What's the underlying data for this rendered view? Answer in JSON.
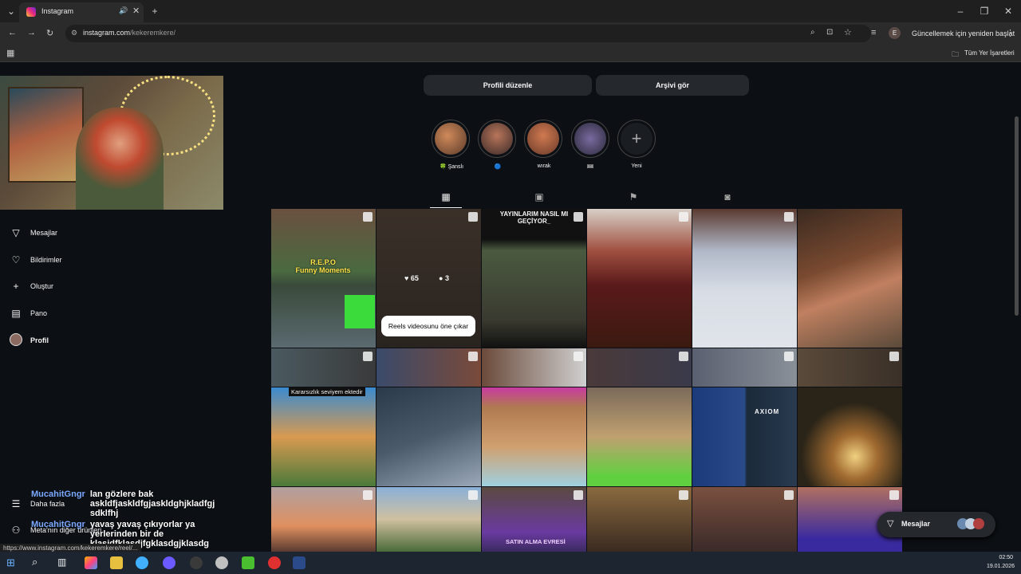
{
  "browser": {
    "tab_title": "Instagram",
    "url_host": "instagram.com",
    "url_path": "/kekeremkere/",
    "update_label": "Güncellemek için yeniden başlat",
    "profile_initial": "E",
    "bookmarks_label": "Tüm Yer İşaretleri"
  },
  "profile": {
    "edit_button": "Profili düzenle",
    "archive_button": "Arşivi gör"
  },
  "highlights": [
    {
      "label": "🍀 Şanslı"
    },
    {
      "label": "🔵"
    },
    {
      "label": "wırak"
    },
    {
      "label": "🎟"
    },
    {
      "label": "Yeni"
    }
  ],
  "sidebar": {
    "items": [
      {
        "label": "Mesajlar",
        "icon": "send-icon"
      },
      {
        "label": "Bildirimler",
        "icon": "heart-icon"
      },
      {
        "label": "Oluştur",
        "icon": "plus-icon"
      },
      {
        "label": "Pano",
        "icon": "dashboard-icon"
      },
      {
        "label": "Profil",
        "icon": "avatar-icon"
      }
    ],
    "more_label": "Daha fazla",
    "meta_label": "Meta'nın diğer ürünleri"
  },
  "posts": {
    "hover_likes": "65",
    "hover_comments": "3",
    "pin_tooltip": "Reels videosunu öne çıkar",
    "caption_repo": "R.E.P.O\nFunny Moments",
    "caption_stream": "YAYINLARIM NASIL MI\nGEÇİYOR_",
    "caption_kararsizlik": "Kararsızlık seviyem ektedir",
    "caption_axiom": "AXIOM",
    "caption_satin": "SATIN ALMA EVRESİ"
  },
  "chat": [
    {
      "name": "MucahitGngr",
      "message": "lan gözlere bak askldfjaskldfgjaskldghjkladfgj sdklfhj"
    },
    {
      "name": "MucahitGngr",
      "message": "yavaş yavaş çıkıyorlar ya yerlerinden bir de klasjdfklasdjfgklasdgjklasdg"
    }
  ],
  "status_url": "https://www.instagram.com/kekeremkere/reel/...",
  "messages_widget": {
    "label": "Mesajlar"
  },
  "taskbar": {
    "time": "02:50",
    "date": "19.01.2026"
  },
  "colors": {
    "bg": "#0c1014",
    "button": "#25292e",
    "accent": "#0095f6"
  }
}
